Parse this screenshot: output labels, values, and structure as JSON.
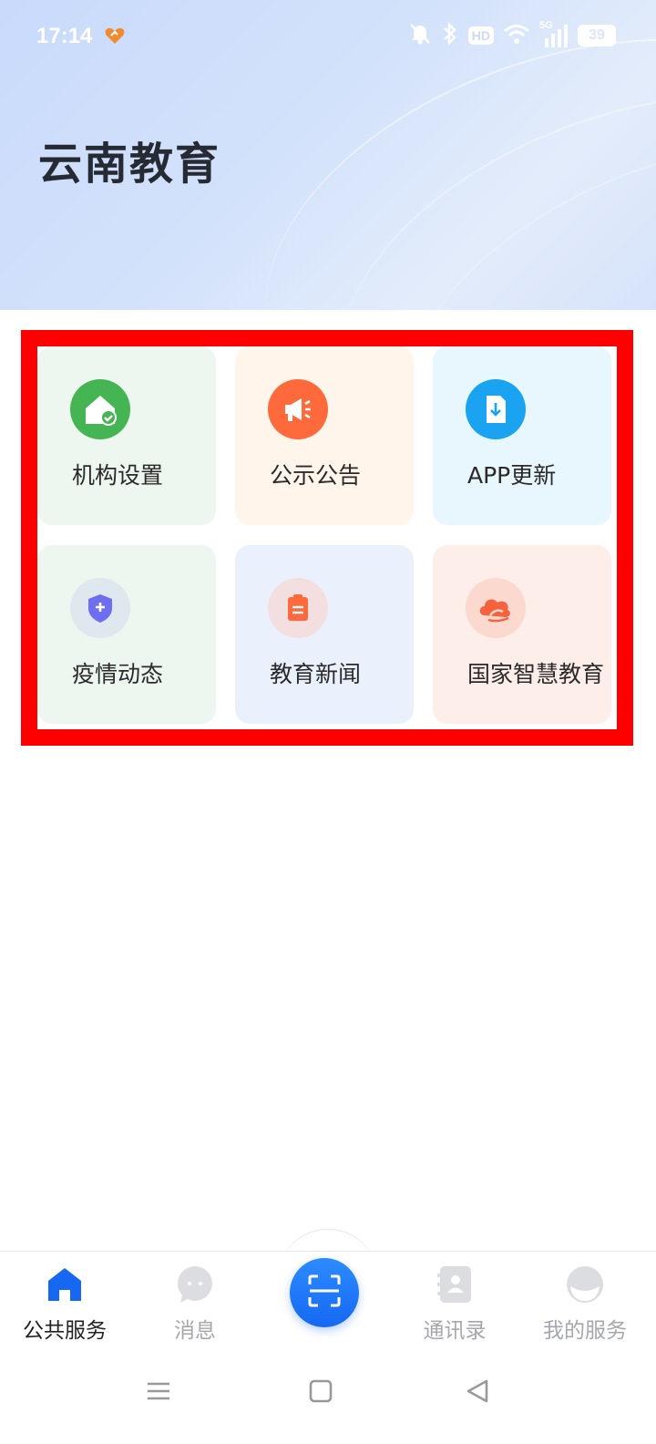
{
  "status_bar": {
    "time": "17:14",
    "hd_label": "HD",
    "network": "5G",
    "battery": "39"
  },
  "app_title": "云南教育",
  "grid": [
    {
      "label": "机构设置",
      "icon": "house-check-icon",
      "bg": "#eef7ef",
      "icon_bg": "#45b553"
    },
    {
      "label": "公示公告",
      "icon": "megaphone-icon",
      "bg": "#fff5ea",
      "icon_bg": "#ff6a3d"
    },
    {
      "label": "APP更新",
      "icon": "download-file-icon",
      "bg": "#e8f6fd",
      "icon_bg": "#1aa3f0"
    },
    {
      "label": "疫情动态",
      "icon": "shield-plus-icon",
      "bg": "#edf6ef",
      "icon_bg": "#dfe7ef"
    },
    {
      "label": "教育新闻",
      "icon": "clipboard-icon",
      "bg": "#eaf1fc",
      "icon_bg": "#f3dfe0"
    },
    {
      "label": "国家智慧教育",
      "icon": "cloud-book-icon",
      "bg": "#fdeeea",
      "icon_bg": "#fcd9cf"
    }
  ],
  "bottom_nav": {
    "items": [
      {
        "label": "公共服务",
        "icon": "home-icon"
      },
      {
        "label": "消息",
        "icon": "chat-icon"
      },
      {
        "label": "通讯录",
        "icon": "contacts-icon"
      },
      {
        "label": "我的服务",
        "icon": "profile-icon"
      }
    ],
    "center": "scan-icon"
  },
  "colors": {
    "accent": "#1668f2",
    "highlight": "#ff0000",
    "header_bg": "#d3e2fb"
  }
}
